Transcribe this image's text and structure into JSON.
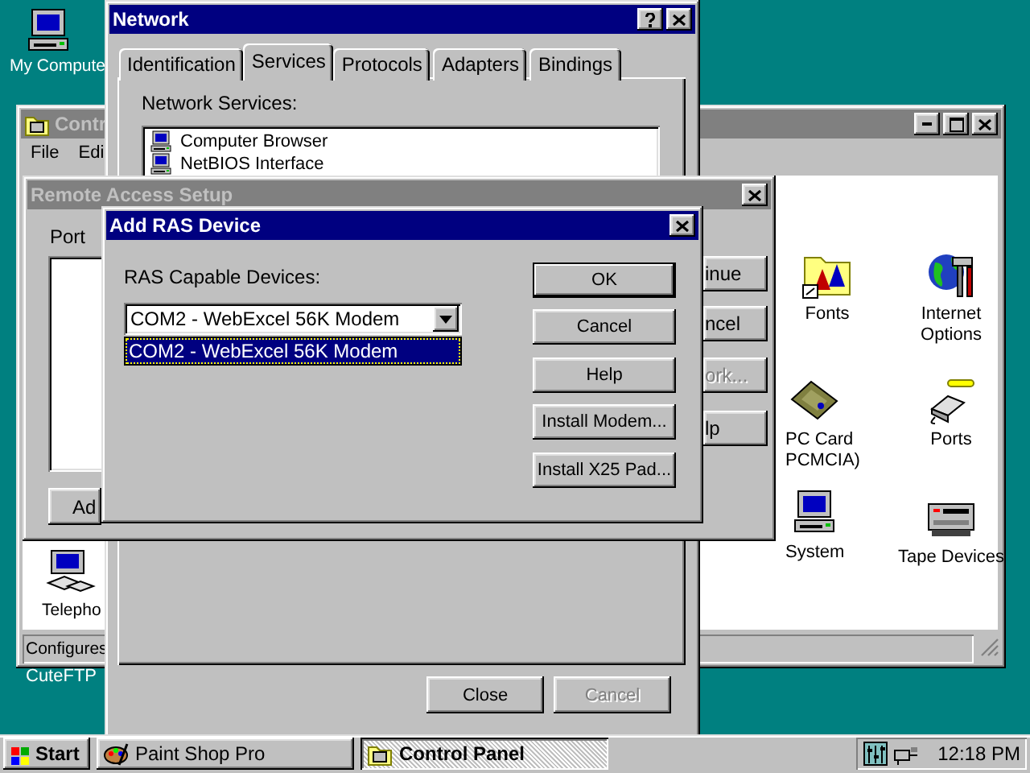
{
  "desktop": {
    "icons": [
      {
        "label": "My Compute",
        "kind": "computer"
      },
      {
        "label": "CuteFTP"
      }
    ]
  },
  "control_panel": {
    "title": "Contr",
    "active": false,
    "menu": [
      "File",
      "Edi"
    ],
    "items": [
      {
        "kind": "fonts",
        "lines": [
          "Fonts"
        ]
      },
      {
        "kind": "globe",
        "lines": [
          "Internet",
          "Options"
        ]
      },
      {
        "kind": "pccard",
        "lines": [
          "PC Card",
          "PCMCIA)"
        ]
      },
      {
        "kind": "ports",
        "lines": [
          "Ports"
        ]
      },
      {
        "kind": "computer",
        "lines": [
          "System"
        ]
      },
      {
        "kind": "tape",
        "lines": [
          "Tape Devices"
        ]
      },
      {
        "kind": "phone",
        "lines": [
          "Telepho"
        ]
      }
    ],
    "status": "Configures"
  },
  "network": {
    "title": "Network",
    "active": true,
    "tabs": [
      {
        "label": "Identification",
        "selected": false
      },
      {
        "label": "Services",
        "selected": true
      },
      {
        "label": "Protocols",
        "selected": false
      },
      {
        "label": "Adapters",
        "selected": false
      },
      {
        "label": "Bindings",
        "selected": false
      }
    ],
    "services_label": "Network Services:",
    "services": [
      {
        "name": "Computer Browser",
        "kind": "computer"
      },
      {
        "name": "NetBIOS Interface",
        "kind": "computer"
      }
    ],
    "buttons": [
      {
        "label": "Close",
        "disabled": false
      },
      {
        "label": "Cancel",
        "disabled": true
      }
    ]
  },
  "remote_access": {
    "title": "Remote Access Setup",
    "active": false,
    "port_label": "Port",
    "buttons": [
      {
        "label": "Ad",
        "disabled": false
      },
      {
        "label": "inue",
        "disabled": false
      },
      {
        "label": "ncel",
        "disabled": false
      },
      {
        "label": "ork...",
        "disabled": true
      },
      {
        "label": "lp",
        "disabled": false
      }
    ]
  },
  "add_ras": {
    "title": "Add RAS Device",
    "active": true,
    "devices_label": "RAS Capable Devices:",
    "value": "COM2 - WebExcel 56K Modem",
    "options": [
      {
        "label": "COM2 - WebExcel 56K Modem",
        "selected": true
      }
    ],
    "buttons": [
      {
        "label": "OK",
        "default": true
      },
      {
        "label": "Cancel",
        "default": false
      },
      {
        "label": "Help",
        "default": false
      },
      {
        "label": "Install Modem...",
        "default": false
      },
      {
        "label": "Install X25 Pad...",
        "default": false
      }
    ]
  },
  "taskbar": {
    "start": "Start",
    "tasks": [
      {
        "label": "Paint Shop Pro",
        "kind": "paint",
        "selected": false
      },
      {
        "label": "Control Panel",
        "kind": "folder",
        "selected": true
      }
    ],
    "clock": "12:18 PM"
  }
}
